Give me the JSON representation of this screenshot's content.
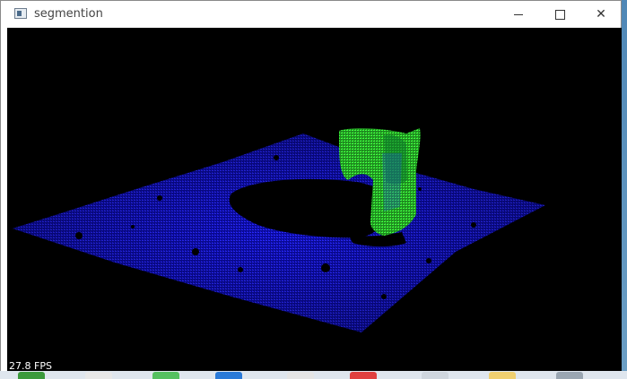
{
  "window": {
    "title": "segmention",
    "app_icon": "window-app-icon",
    "controls": [
      "minimize",
      "maximize",
      "close"
    ]
  },
  "viewport": {
    "background": "#000000",
    "fps_label": "27.8 FPS",
    "scene": {
      "description_colors": {
        "plane": "#1a1aff",
        "object": "#33ff33"
      }
    }
  },
  "taskbar": {
    "items": [
      "app-1",
      "app-2",
      "app-3",
      "app-4",
      "app-5",
      "app-6",
      "app-7",
      "app-8"
    ]
  }
}
